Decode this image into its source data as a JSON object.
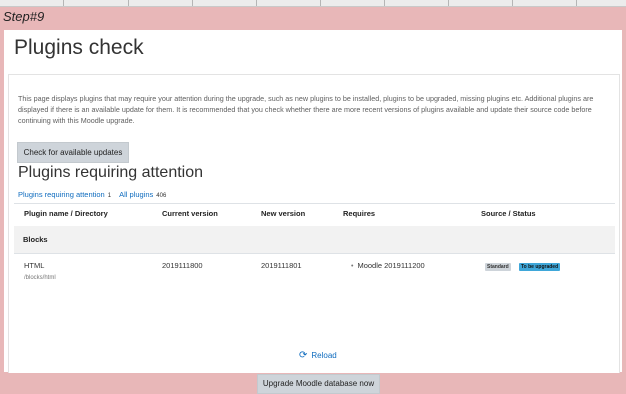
{
  "step_label": "Step#9",
  "page_title": "Plugins check",
  "intro_text": "This page displays plugins that may require your attention during the upgrade, such as new plugins to be installed, plugins to be upgraded, missing plugins etc. Additional plugins are displayed if there is an available update for them. It is recommended that you check whether there are more recent versions of plugins available and update their source code before continuing with this Moodle upgrade.",
  "buttons": {
    "check_updates": "Check for available updates",
    "upgrade_db": "Upgrade Moodle database now"
  },
  "section_title": "Plugins requiring attention",
  "filters": [
    {
      "label": "Plugins requiring attention",
      "count": "1"
    },
    {
      "label": "All plugins",
      "count": "406"
    }
  ],
  "table": {
    "headers": [
      "Plugin name / Directory",
      "Current version",
      "New version",
      "Requires",
      "Source / Status"
    ],
    "group": "Blocks",
    "row": {
      "name": "HTML",
      "directory": "/blocks/html",
      "current_version": "2019111800",
      "new_version": "2019111801",
      "requires": "Moodle 2019111200",
      "badges": [
        "Standard",
        "To be upgraded"
      ]
    }
  },
  "reload": {
    "label": "Reload",
    "icon": "refresh-icon"
  },
  "colors": {
    "outer_background": "#e8b7b8",
    "link": "#0f6cbf",
    "button": "#ced4da",
    "badge_info": "#3fa7d9"
  }
}
